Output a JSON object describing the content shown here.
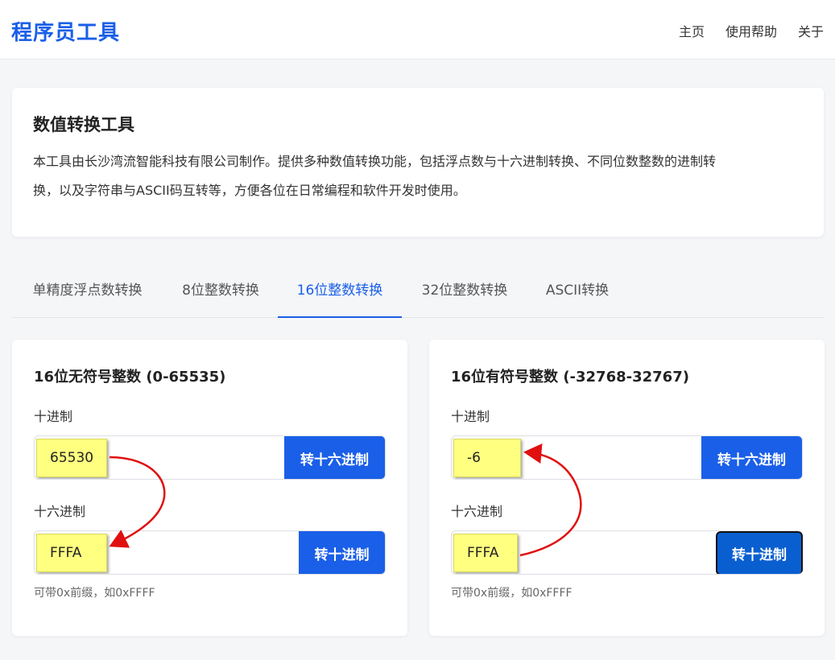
{
  "header": {
    "logo": "程序员工具",
    "nav": [
      "主页",
      "使用帮助",
      "关于"
    ]
  },
  "intro": {
    "title": "数值转换工具",
    "description_line1": "本工具由长沙湾流智能科技有限公司制作。提供多种数值转换功能，包括浮点数与十六进制转换、不同位数整数的进制转",
    "description_line2": "换，以及字符串与ASCII码互转等，方便各位在日常编程和软件开发时使用。"
  },
  "tabs": [
    "单精度浮点数转换",
    "8位整数转换",
    "16位整数转换",
    "32位整数转换",
    "ASCII转换"
  ],
  "active_tab": "16位整数转换",
  "cards": {
    "unsigned": {
      "title": "16位无符号整数 (0-65535)",
      "dec_label": "十进制",
      "dec_value": "65530",
      "dec_button": "转十六进制",
      "hex_label": "十六进制",
      "hex_value": "FFFA",
      "hex_button": "转十进制",
      "hint": "可带0x前缀，如0xFFFF"
    },
    "signed": {
      "title": "16位有符号整数 (-32768-32767)",
      "dec_label": "十进制",
      "dec_value": "-6",
      "dec_button": "转十六进制",
      "hex_label": "十六进制",
      "hex_value": "FFFA",
      "hex_button": "转十进制",
      "hint": "可带0x前缀，如0xFFFF"
    }
  },
  "colors": {
    "accent": "#1a5fe8",
    "highlight": "#ffff80",
    "annotation_arrow": "#e01010"
  }
}
